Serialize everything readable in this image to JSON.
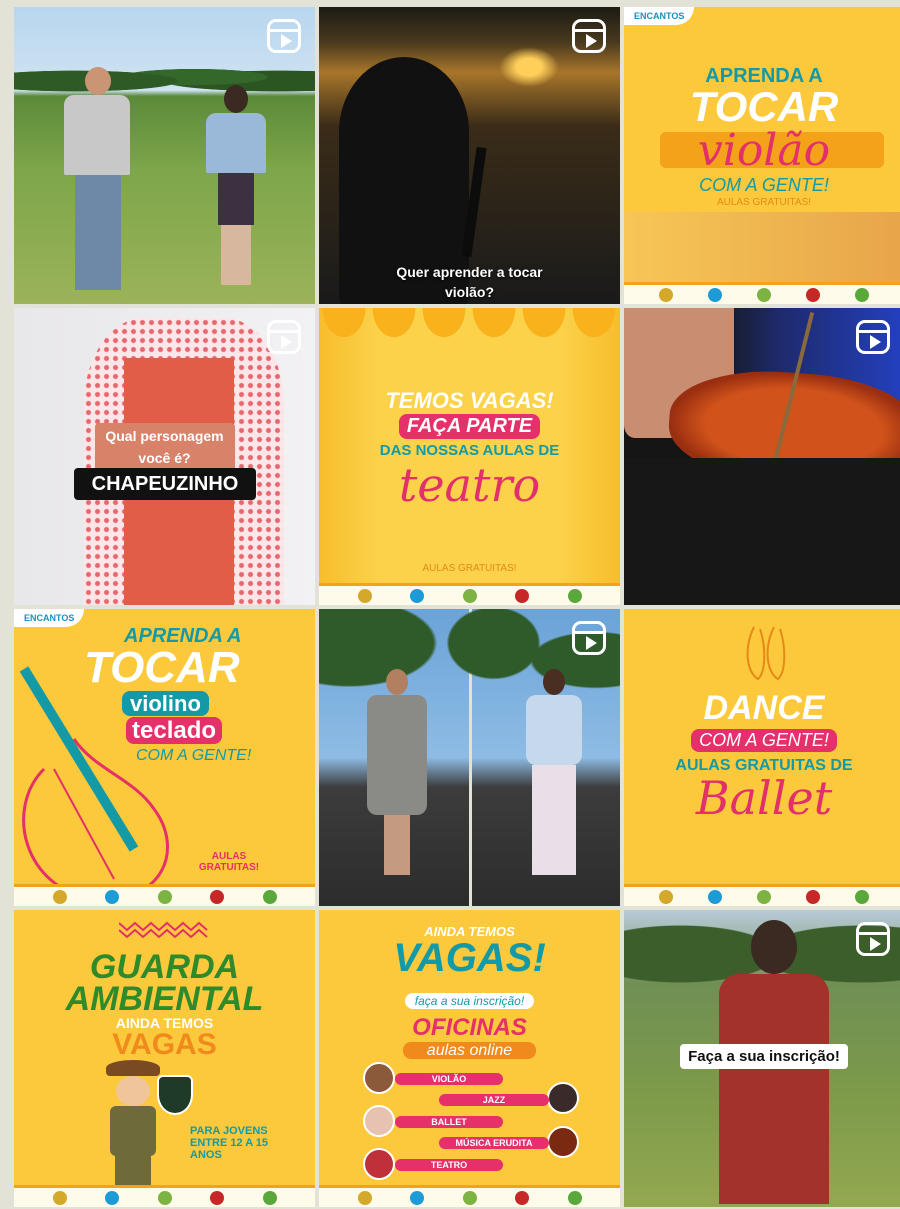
{
  "colors": {
    "yellow": "#fbc93b",
    "pink": "#e5306a",
    "teal": "#139aa6",
    "green": "#2f8a2b",
    "orange": "#f08a1c"
  },
  "tiles": {
    "t3": {
      "title1": "APRENDA A",
      "title2": "TOCAR",
      "script": "violão",
      "sub": "COM A GENTE!",
      "note": "AULAS GRATUITAS!"
    },
    "t2": {
      "caption": "Quer aprender a tocar violão?"
    },
    "t4": {
      "question": "Qual personagem você é?",
      "answer": "CHAPEUZINHO"
    },
    "t5": {
      "l1": "TEMOS VAGAS!",
      "l2": "FAÇA PARTE",
      "l3": "DAS NOSSAS AULAS DE",
      "script": "teatro",
      "note": "AULAS GRATUITAS!"
    },
    "t7": {
      "title1": "APRENDA A",
      "title2": "TOCAR",
      "p1": "violino",
      "p2": "teclado",
      "sub": "COM A GENTE!",
      "note": "AULAS GRATUITAS!"
    },
    "t9": {
      "l1": "DANCE",
      "l2": "COM A GENTE!",
      "l3": "AULAS GRATUITAS DE",
      "script": "Ballet"
    },
    "t10": {
      "l1": "GUARDA",
      "l2": "AMBIENTAL",
      "l3": "AINDA TEMOS",
      "l4": "VAGAS",
      "note": "PARA JOVENS ENTRE 12 A 15 ANOS"
    },
    "t11": {
      "l1": "AINDA TEMOS",
      "l2": "VAGAS!",
      "l3": "faça a sua inscrição!",
      "l4": "OFICINAS",
      "l5": "aulas online",
      "items": [
        "VIOLÃO",
        "JAZZ",
        "BALLET",
        "MÚSICA ERUDITA",
        "TEATRO"
      ]
    },
    "t12": {
      "caption": "Faça a sua inscrição!"
    }
  }
}
